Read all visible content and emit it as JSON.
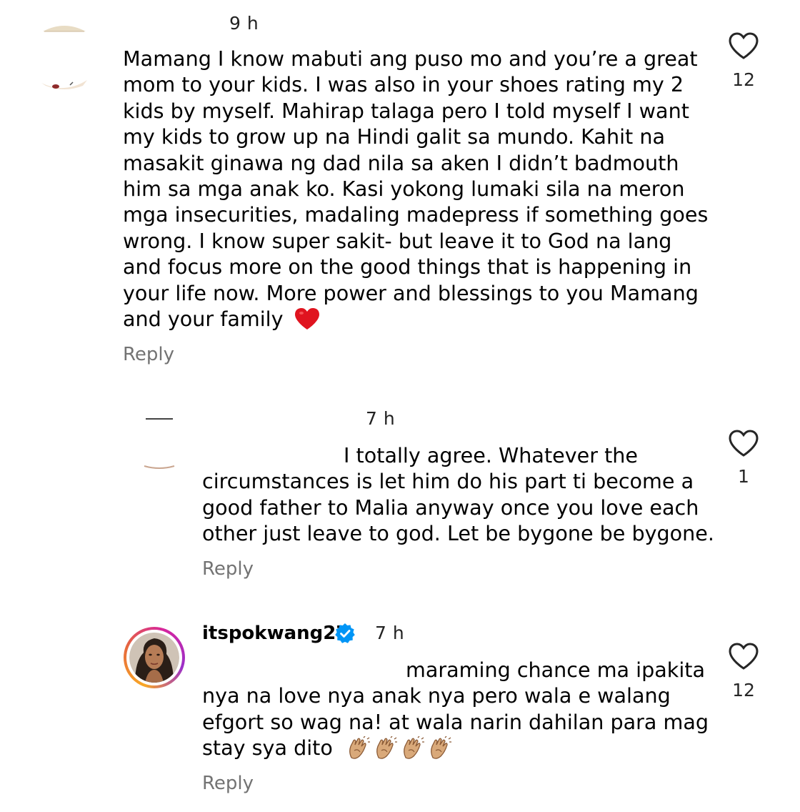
{
  "comments": [
    {
      "time": "9 h",
      "lines": [
        "Mamang I know mabuti ang puso mo and you’re a great",
        "mom to your kids.  I was also in your shoes rating my 2",
        "kids by myself.  Mahirap talaga pero I told myself I want",
        "my kids to grow up na Hindi galit sa mundo.  Kahit na",
        "masakit ginawa ng dad nila sa aken I didn’t badmouth",
        "him sa mga anak ko.  Kasi yokong lumaki sila na meron",
        "mga insecurities, madaling madepress if something goes",
        "wrong.  I know super sakit- but leave it to God na lang",
        "and focus more on the good things that is happening in",
        "your life now.  More power and blessings to you Mamang",
        "and your family"
      ],
      "emoji": "red-heart",
      "reply_label": "Reply",
      "like_count": "12"
    },
    {
      "time": "7 h",
      "lines": [
        "I totally agree. Whatever the",
        "circumstances is  let him do his part ti become a",
        "good  father to Malia  anyway once you love each",
        "other just leave to god. Let be bygone be bygone."
      ],
      "reply_label": "Reply",
      "like_count": "1"
    },
    {
      "username": "itspokwang27",
      "time": "7 h",
      "lines": [
        "maraming chance ma ipakita",
        "nya na love nya anak nya pero wala e walang",
        "efgort so wag na! at wala narin dahilan para mag",
        "stay sya dito"
      ],
      "emoji": "clapping-hands",
      "emoji_count": 4,
      "reply_label": "Reply",
      "like_count": "12"
    }
  ],
  "colors": {
    "secondary_text": "#737373",
    "verified_blue": "#0095f6",
    "heart_red": "#e0141f",
    "story_ring_start": "#f9a825",
    "story_ring_end": "#d6249f",
    "clap_skin": "#d9a97a"
  },
  "icons": {
    "like": "heart-outline-icon",
    "verified": "verified-badge-icon"
  }
}
